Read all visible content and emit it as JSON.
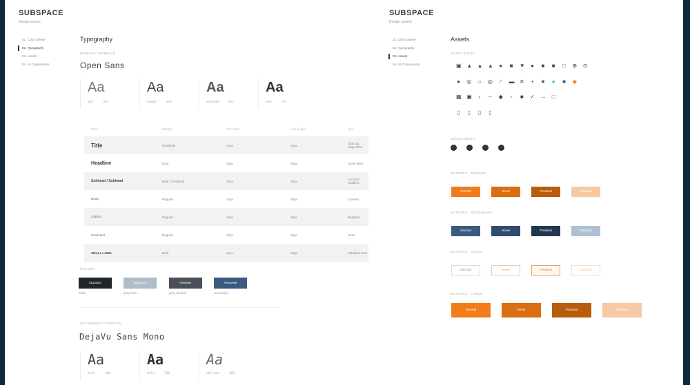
{
  "left_panel": {
    "brand": {
      "title": "SUBSPACE",
      "subtitle": "Design system"
    },
    "nav": [
      "01. Color palette",
      "02. Typography",
      "03. Assets",
      "04. UI Components"
    ],
    "section_title": "Typography",
    "primary_caption": "PRIMARY TYPEFACE",
    "primary_font": "Open Sans",
    "primary_weights": [
      {
        "sample": "Aa",
        "label": "light",
        "value": "300"
      },
      {
        "sample": "Aa",
        "label": "regular",
        "value": "400"
      },
      {
        "sample": "Aa",
        "label": "semibold",
        "value": "600"
      },
      {
        "sample": "Aa",
        "label": "bold",
        "value": "700"
      }
    ],
    "table": {
      "headers": [
        "Style",
        "Weight",
        "Font size",
        "Line height",
        "Use"
      ],
      "rows": [
        [
          "Title",
          "Semibold",
          "24px",
          "32px",
          "Sign Up, Page titles"
        ],
        [
          "Headline",
          "Bold",
          "20px",
          "28px",
          "Grant titles"
        ],
        [
          "Subhead / Subhead",
          "Bold / Semibold",
          "16px",
          "18px",
          "Account headers"
        ],
        [
          "Body",
          "Regular",
          "14px",
          "20px",
          "Content"
        ],
        [
          "Callout",
          "Regular",
          "14px",
          "18px",
          "Bodylike"
        ],
        [
          "Small text",
          "Regular",
          "12px",
          "16px",
          "Hints"
        ],
        [
          "SMALL LABEL",
          "Bold",
          "11px",
          "13px",
          "Validation text"
        ]
      ]
    },
    "colors_caption": "COLORS",
    "swatches": [
      {
        "hex": "#22252A",
        "label": "black"
      },
      {
        "hex": "#B0BCC7",
        "label": "gray-form"
      },
      {
        "hex": "#495057",
        "label": "gray-darkest"
      },
      {
        "hex": "#3A5A80",
        "label": "secondary"
      }
    ],
    "secondary_caption": "SECONDARY TYPEFACE",
    "secondary_font": "DejaVu Sans Mono",
    "secondary_weights": [
      {
        "sample": "Aa",
        "label": "book",
        "value": "400"
      },
      {
        "sample": "Aa",
        "label": "bold",
        "value": "700"
      },
      {
        "sample": "Aa",
        "label": "oblique",
        "value": "400"
      }
    ]
  },
  "right_panel": {
    "brand": {
      "title": "SUBSPACE",
      "subtitle": "Design system"
    },
    "nav": [
      "01. Color palette",
      "02. Typography",
      "03. Assets",
      "04. UI Components"
    ],
    "section_title": "Assets",
    "glyph_caption": "GLYPH ICONS",
    "icon_rows": [
      [
        "users-icon",
        "user-add-icon",
        "bell-icon",
        "alert-icon",
        "help-icon",
        "badge-icon",
        "trophy-icon",
        "person-icon",
        "flag-icon",
        "message-icon",
        "window-icon",
        "plus-circle-icon",
        "logout-icon"
      ],
      [
        "circle-icon",
        "info-icon",
        "search-icon",
        "eye-icon",
        "pencil-icon",
        "card-icon",
        "close-icon",
        "pin-icon",
        "star-icon",
        "dot-icon",
        "tag-icon",
        "ticket-icon"
      ],
      [
        "grid-icon",
        "expand-icon",
        "share-icon",
        "minus-icon",
        "shield-icon",
        "copy-icon",
        "trash-icon",
        "check-icon",
        "arrow-icon",
        "chat-icon"
      ],
      [
        "doc-icon",
        "doc-edit-icon",
        "doc-check-icon",
        "doc-grid-icon"
      ]
    ],
    "social_caption": "SOCIAL MEDIA",
    "social_icons": [
      "github-icon",
      "dribbble-icon",
      "globe-icon",
      "twitter-icon"
    ],
    "button_groups": [
      {
        "caption": "BUTTONS · PRIMARY",
        "labels": [
          "Normal",
          "Hover",
          "Pressed",
          "Disabled"
        ]
      },
      {
        "caption": "BUTTONS · SECONDARY",
        "labels": [
          "Normal",
          "Hover",
          "Pressed",
          "Disabled"
        ]
      },
      {
        "caption": "BUTTONS · GHOST",
        "labels": [
          "Normal",
          "Hover",
          "Pressed",
          "Disabled"
        ]
      },
      {
        "caption": "BUTTONS · LARGE",
        "labels": [
          "Normal",
          "Hover",
          "Pressed",
          "Disabled"
        ]
      }
    ],
    "colors": {
      "primary": [
        "#F07D1A",
        "#D96E12",
        "#B95C0C",
        "#F6C9A3"
      ],
      "secondary": [
        "#3A5A80",
        "#2F4C6E",
        "#23384F",
        "#AFC0D2"
      ],
      "large": [
        "#F07D1A",
        "#D96E12",
        "#B95C0C",
        "#F6C9A3"
      ]
    }
  }
}
